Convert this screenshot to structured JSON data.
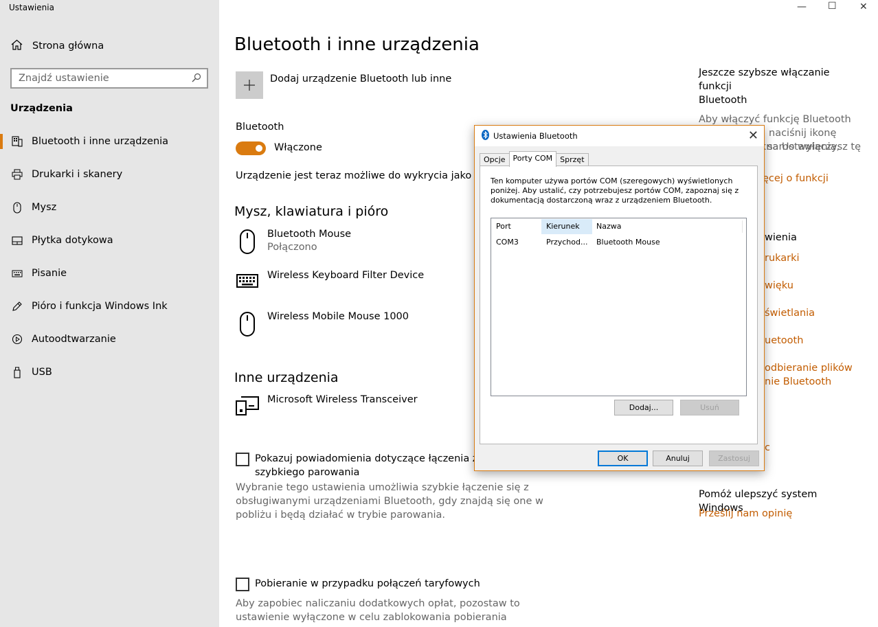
{
  "window": {
    "title": "Ustawienia",
    "controls": {
      "minimize": "—",
      "maximize": "☐",
      "close": "✕"
    }
  },
  "sidebar": {
    "home_label": "Strona główna",
    "search_placeholder": "Znajdź ustawienie",
    "section_label": "Urządzenia",
    "items": [
      {
        "label": "Bluetooth i inne urządzenia",
        "icon": "bluetooth-devices-icon",
        "active": true
      },
      {
        "label": "Drukarki i skanery",
        "icon": "printer-icon"
      },
      {
        "label": "Mysz",
        "icon": "mouse-icon"
      },
      {
        "label": "Płytka dotykowa",
        "icon": "touchpad-icon"
      },
      {
        "label": "Pisanie",
        "icon": "keyboard-icon"
      },
      {
        "label": "Pióro i funkcja Windows Ink",
        "icon": "pen-icon"
      },
      {
        "label": "Autoodtwarzanie",
        "icon": "autoplay-icon"
      },
      {
        "label": "USB",
        "icon": "usb-icon"
      }
    ]
  },
  "main": {
    "title": "Bluetooth i inne urządzenia",
    "add_device_label": "Dodaj urządzenie Bluetooth lub inne",
    "bluetooth_label": "Bluetooth",
    "toggle_state": "Włączone",
    "discoverable_text": "Urządzenie jest teraz możliwe do wykrycia jako „PRIM",
    "mouse_section": "Mysz, klawiatura i pióro",
    "devices": [
      {
        "name": "Bluetooth Mouse",
        "status": "Połączono",
        "icon": "mouse-icon"
      },
      {
        "name": "Wireless Keyboard Filter Device",
        "status": "",
        "icon": "keyboard-icon"
      },
      {
        "name": "Wireless Mobile Mouse 1000",
        "status": "",
        "icon": "mouse-icon"
      }
    ],
    "other_section": "Inne urządzenia",
    "other_devices": [
      {
        "name": "Microsoft Wireless Transceiver",
        "icon": "transceiver-icon"
      }
    ],
    "swift_pair_label_1": "Pokazuj powiadomienia dotyczące łączenia za po",
    "swift_pair_label_2": "szybkiego parowania",
    "swift_pair_desc_1": "Wybranie tego ustawienia umożliwia szybkie łączenie się z",
    "swift_pair_desc_2": "obsługiwanymi urządzeniami Bluetooth, gdy znajdą się one w",
    "swift_pair_desc_3": "pobliżu i będą działać w trybie parowania.",
    "metered_label": "Pobieranie w przypadku połączeń taryfowych",
    "metered_desc_1": "Aby zapobiec naliczaniu dodatkowych opłat, pozostaw to",
    "metered_desc_2": "ustawienie wyłączone w celu zablokowania pobierania"
  },
  "right": {
    "heading_1": "Jeszcze szybsze włączanie funkcji",
    "heading_2": "Bluetooth",
    "text_1": "Aby włączyć funkcję Bluetooth bez",
    "text_2": "otwierania okna Ustawienia, otwórz",
    "text_3": "naciśnij ikonę",
    "text_4": "samo wyłączysz tę",
    "learn_more": "ęcej o funkcji",
    "related_heading": "wienia",
    "links": [
      "rukarki",
      "więku",
      "świetlania",
      "uetooth",
      "odbieranie plików",
      "nie Bluetooth"
    ],
    "trailing_link_char": "c",
    "improve_heading": "Pomóż ulepszyć system Windows",
    "feedback_link": "Prześlij nam opinię"
  },
  "dialog": {
    "title": "Ustawienia Bluetooth",
    "close": "✕",
    "tabs": [
      {
        "label": "Opcje",
        "active": false
      },
      {
        "label": "Porty COM",
        "active": true
      },
      {
        "label": "Sprzęt",
        "active": false
      }
    ],
    "description": "Ten komputer używa portów COM (szeregowych) wyświetlonych poniżej. Aby ustalić, czy potrzebujesz portów COM, zapoznaj się z dokumentacją dostarczoną wraz z urządzeniem Bluetooth.",
    "columns": {
      "port": "Port",
      "direction": "Kierunek",
      "name": "Nazwa"
    },
    "rows": [
      {
        "port": "COM3",
        "direction": "Przychod...",
        "name": "Bluetooth Mouse"
      }
    ],
    "add_button": "Dodaj...",
    "remove_button": "Usuń",
    "ok_button": "OK",
    "cancel_button": "Anuluj",
    "apply_button": "Zastosuj"
  },
  "colors": {
    "accent": "#da7b10",
    "link": "#c25c00",
    "sidebar_bg": "#e6e6e6"
  }
}
